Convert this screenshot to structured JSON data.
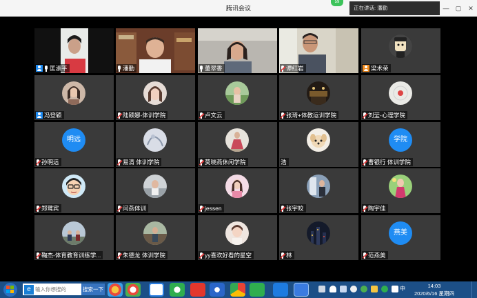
{
  "window": {
    "title": "腾讯会议",
    "network_badge": "59",
    "speaking_label": "正在讲话: 潘勤",
    "controls": [
      "—",
      "▢",
      "✕"
    ]
  },
  "participants": [
    {
      "name": "匡淑平",
      "mic": "on",
      "badge": "host"
    },
    {
      "name": "潘勤",
      "mic": "on",
      "badge": "",
      "active": true
    },
    {
      "name": "董翠香",
      "mic": "on",
      "badge": ""
    },
    {
      "name": "谭红岩",
      "mic": "muted",
      "badge": ""
    },
    {
      "name": "梁术荣",
      "mic": "none",
      "badge": "cohost"
    },
    {
      "name": "冯登颖",
      "mic": "none",
      "badge": "host"
    },
    {
      "name": "陆颖娜-体训学院",
      "mic": "muted",
      "badge": ""
    },
    {
      "name": "卢文云",
      "mic": "muted",
      "badge": ""
    },
    {
      "name": "张琦+体教运训学院",
      "mic": "muted",
      "badge": ""
    },
    {
      "name": "刘莹-心理学院",
      "mic": "muted",
      "badge": ""
    },
    {
      "name": "孙明远",
      "mic": "muted",
      "badge": "",
      "avatar_text": "明远"
    },
    {
      "name": "易清 体训学院",
      "mic": "muted",
      "badge": ""
    },
    {
      "name": "莫晓燕休闲学院",
      "mic": "muted",
      "badge": ""
    },
    {
      "name": "浩",
      "mic": "none",
      "badge": ""
    },
    {
      "name": "曹银行 体训学院",
      "mic": "muted",
      "badge": "",
      "avatar_text": "学院"
    },
    {
      "name": "郑鹭宾",
      "mic": "muted",
      "badge": ""
    },
    {
      "name": "闫燕体训",
      "mic": "muted",
      "badge": ""
    },
    {
      "name": "jessen",
      "mic": "muted",
      "badge": ""
    },
    {
      "name": "张宇皎",
      "mic": "muted",
      "badge": ""
    },
    {
      "name": "陶宇佳",
      "mic": "muted",
      "badge": ""
    },
    {
      "name": "鞠杰-体育教育训练学...",
      "mic": "muted",
      "badge": ""
    },
    {
      "name": "朱德龙 体训学院",
      "mic": "muted",
      "badge": ""
    },
    {
      "name": "yy喜欢好看的星空",
      "mic": "muted",
      "badge": ""
    },
    {
      "name": "林",
      "mic": "muted",
      "badge": ""
    },
    {
      "name": "范燕美",
      "mic": "muted",
      "badge": "",
      "avatar_text": "燕美"
    }
  ],
  "taskbar": {
    "search_placeholder": "输入你想搜的",
    "search_button": "搜索一下",
    "time": "14:03",
    "date": "2020/6/16 星期四",
    "ime_label": "中"
  },
  "colors": {
    "active_speaker": "#5bbf4a",
    "text_avatar": "#1f8cf3",
    "taskbar": "#1c4f87"
  }
}
